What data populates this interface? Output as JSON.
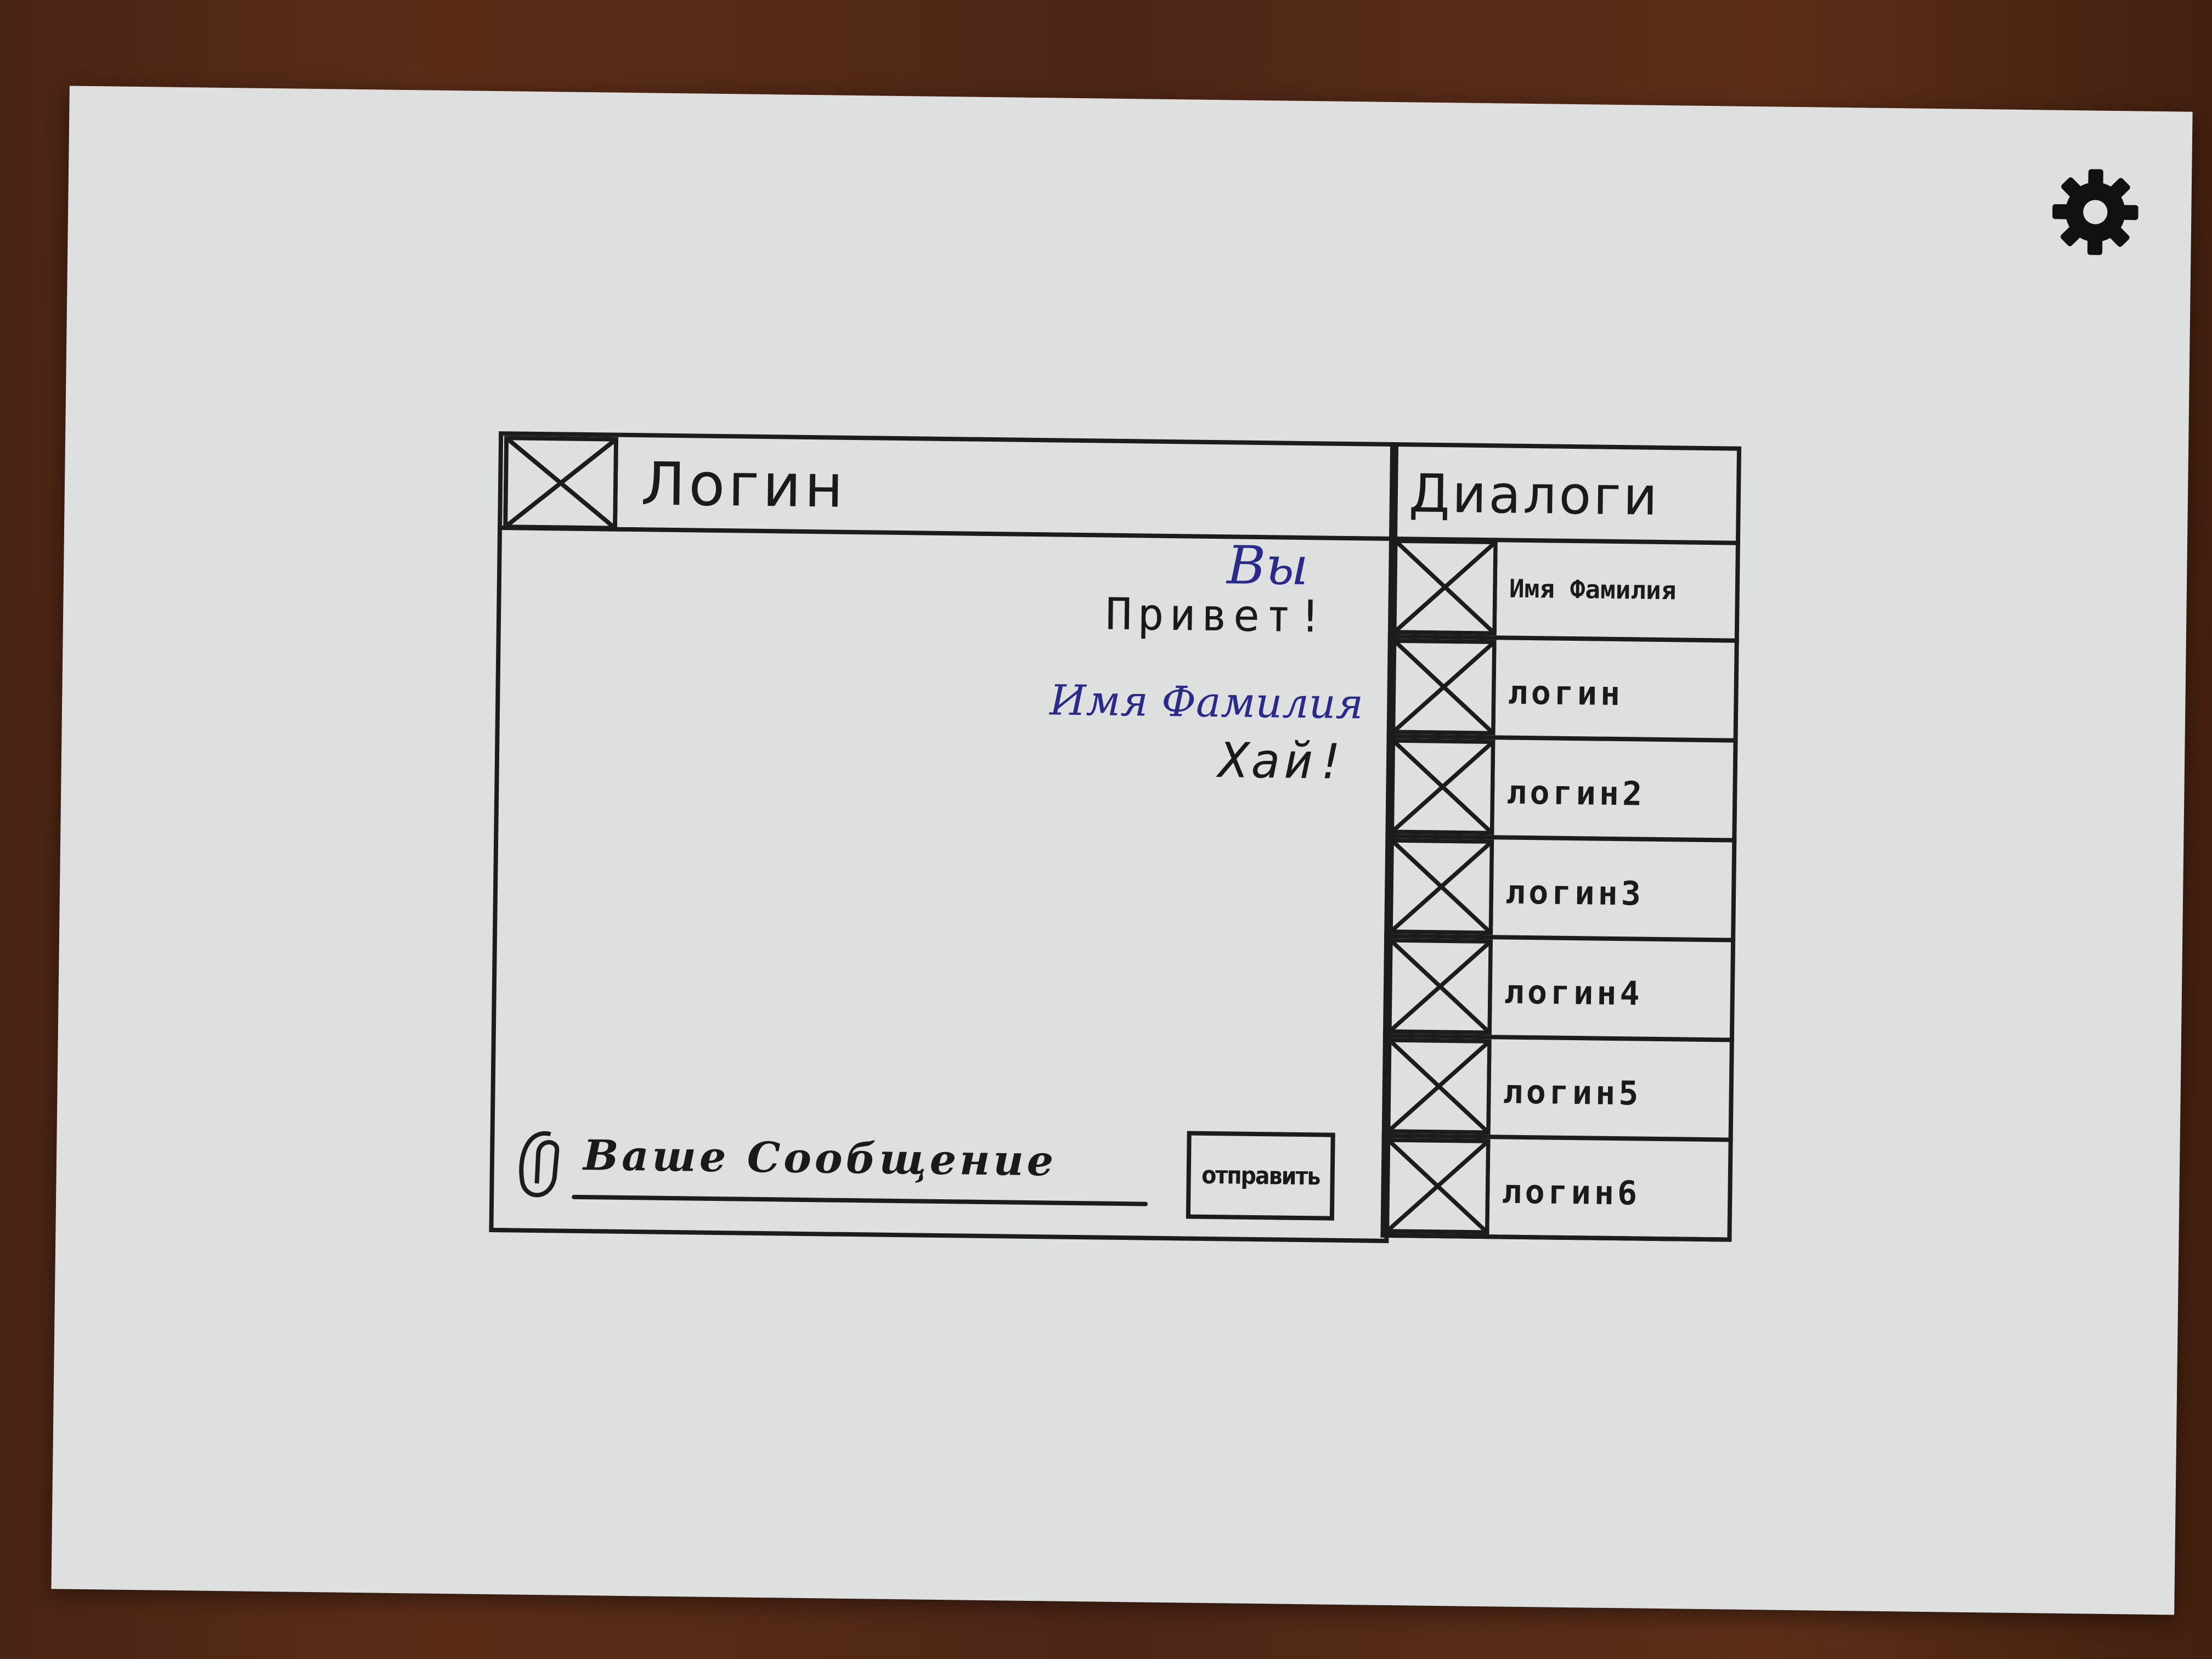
{
  "header": {
    "login_title": "Логин"
  },
  "dialogs": {
    "title": "Диалоги",
    "items": [
      {
        "label": "Имя Фамилия"
      },
      {
        "label": "логин"
      },
      {
        "label": "логин2"
      },
      {
        "label": "логин3"
      },
      {
        "label": "логин4"
      },
      {
        "label": "логин5"
      },
      {
        "label": "логин6"
      }
    ]
  },
  "chat": {
    "messages": [
      {
        "author": "Вы",
        "text": "Привет!"
      },
      {
        "author": "Имя Фамилия",
        "text": "Хай!"
      }
    ]
  },
  "composer": {
    "placeholder": "Ваше Сообщение",
    "send_label": "отправить"
  },
  "icons": {
    "settings": "gear-icon",
    "attach": "paperclip-icon",
    "avatar": "image-placeholder-icon"
  },
  "colors": {
    "ink": "#1c1c1c",
    "author_ink": "#2a2a8a",
    "paper": "#dde0df"
  }
}
